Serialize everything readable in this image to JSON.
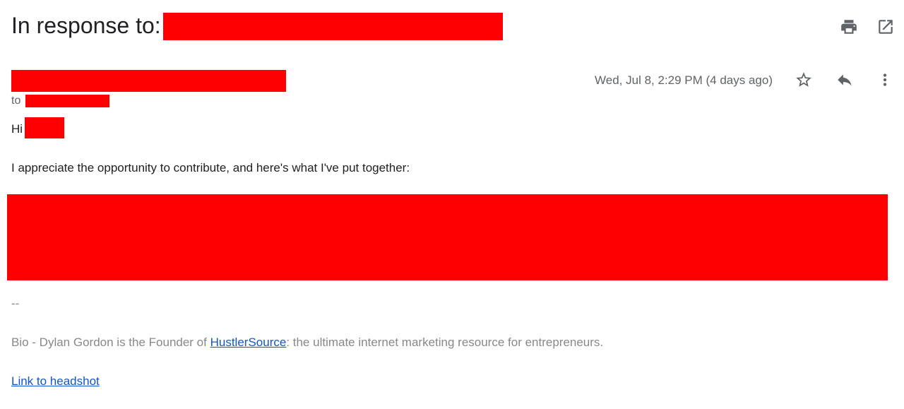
{
  "email": {
    "subject": "In response to:",
    "date": "Wed, Jul 8, 2:29 PM (4 days ago)",
    "to_label": "to",
    "greeting": "Hi",
    "intro": "I appreciate the opportunity to contribute, and here's what I've put together:",
    "signature": {
      "separator": "--",
      "bio_prefix": "Bio - Dylan Gordon is the Founder of ",
      "bio_link": "HustlerSource",
      "bio_suffix": ": the ultimate internet marketing resource for entrepreneurs.",
      "headshot_link": "Link to headshot"
    }
  },
  "icons": {
    "print": "print-icon",
    "open_new_window": "open-in-new-window-icon",
    "star": "star-icon",
    "reply": "reply-icon",
    "more": "more-vertical-icon"
  },
  "colors": {
    "redaction": "#ff0000",
    "link": "#1155cc",
    "muted_text": "#5f6368",
    "signature_text": "#888888"
  }
}
